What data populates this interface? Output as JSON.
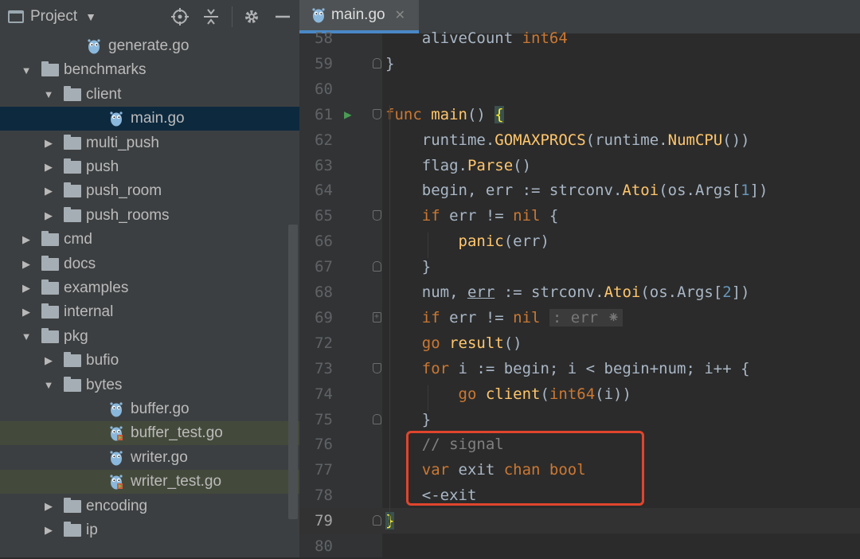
{
  "project_panel": {
    "title": "Project",
    "tree": [
      {
        "label": "generate.go",
        "type": "go",
        "indent": 110,
        "state": ""
      },
      {
        "label": "benchmarks",
        "type": "folder",
        "indent": 54,
        "expanded": true
      },
      {
        "label": "client",
        "type": "folder",
        "indent": 82,
        "expanded": true
      },
      {
        "label": "main.go",
        "type": "go",
        "indent": 138,
        "state": "selected"
      },
      {
        "label": "multi_push",
        "type": "folder",
        "indent": 82,
        "expanded": false
      },
      {
        "label": "push",
        "type": "folder",
        "indent": 82,
        "expanded": false
      },
      {
        "label": "push_room",
        "type": "folder",
        "indent": 82,
        "expanded": false
      },
      {
        "label": "push_rooms",
        "type": "folder",
        "indent": 82,
        "expanded": false
      },
      {
        "label": "cmd",
        "type": "folder",
        "indent": 54,
        "expanded": false
      },
      {
        "label": "docs",
        "type": "folder",
        "indent": 54,
        "expanded": false
      },
      {
        "label": "examples",
        "type": "folder",
        "indent": 54,
        "expanded": false
      },
      {
        "label": "internal",
        "type": "folder",
        "indent": 54,
        "expanded": false
      },
      {
        "label": "pkg",
        "type": "folder",
        "indent": 54,
        "expanded": true
      },
      {
        "label": "bufio",
        "type": "folder",
        "indent": 82,
        "expanded": false
      },
      {
        "label": "bytes",
        "type": "folder",
        "indent": 82,
        "expanded": true
      },
      {
        "label": "buffer.go",
        "type": "go",
        "indent": 138,
        "state": ""
      },
      {
        "label": "buffer_test.go",
        "type": "gotest",
        "indent": 138,
        "state": "modified"
      },
      {
        "label": "writer.go",
        "type": "go",
        "indent": 138,
        "state": ""
      },
      {
        "label": "writer_test.go",
        "type": "gotest",
        "indent": 138,
        "state": "modified"
      },
      {
        "label": "encoding",
        "type": "folder",
        "indent": 82,
        "expanded": false
      },
      {
        "label": "ip",
        "type": "folder",
        "indent": 82,
        "expanded": false
      }
    ],
    "icons": [
      "window-icon",
      "target-icon",
      "collapse-icon",
      "gear-icon",
      "minimize-icon"
    ]
  },
  "editor": {
    "tab": {
      "label": "main.go"
    },
    "lines": [
      {
        "no": "58",
        "tokens": [
          [
            "p",
            "    aliveCount "
          ],
          [
            "k",
            "int64"
          ]
        ]
      },
      {
        "no": "59",
        "tokens": [
          [
            "p",
            "}"
          ]
        ],
        "fold": "up"
      },
      {
        "no": "60",
        "tokens": []
      },
      {
        "no": "61",
        "tokens": [
          [
            "k",
            "func "
          ],
          [
            "fn",
            "main"
          ],
          [
            "p",
            "() "
          ],
          [
            "hl",
            "{"
          ]
        ],
        "run": true,
        "fold": "down"
      },
      {
        "no": "62",
        "tokens": [
          [
            "p",
            "    runtime."
          ],
          [
            "mc",
            "GOMAXPROCS"
          ],
          [
            "p",
            "(runtime."
          ],
          [
            "mc",
            "NumCPU"
          ],
          [
            "p",
            "())"
          ]
        ]
      },
      {
        "no": "63",
        "tokens": [
          [
            "p",
            "    flag."
          ],
          [
            "mc",
            "Parse"
          ],
          [
            "p",
            "()"
          ]
        ]
      },
      {
        "no": "64",
        "tokens": [
          [
            "p",
            "    begin, err := strconv."
          ],
          [
            "mc",
            "Atoi"
          ],
          [
            "p",
            "(os.Args["
          ],
          [
            "num",
            "1"
          ],
          [
            "p",
            "])"
          ]
        ]
      },
      {
        "no": "65",
        "tokens": [
          [
            "k",
            "    if "
          ],
          [
            "p",
            "err != "
          ],
          [
            "k",
            "nil "
          ],
          [
            "p",
            "{"
          ]
        ],
        "fold": "down"
      },
      {
        "no": "66",
        "tokens": [
          [
            "p",
            "        "
          ],
          [
            "fn",
            "panic"
          ],
          [
            "p",
            "(err)"
          ]
        ]
      },
      {
        "no": "67",
        "tokens": [
          [
            "p",
            "    }"
          ]
        ],
        "fold": "up"
      },
      {
        "no": "68",
        "tokens": [
          [
            "p",
            "    num, "
          ],
          [
            "u",
            "err"
          ],
          [
            "p",
            " := strconv."
          ],
          [
            "mc",
            "Atoi"
          ],
          [
            "p",
            "(os.Args["
          ],
          [
            "num",
            "2"
          ],
          [
            "p",
            "])"
          ]
        ]
      },
      {
        "no": "69",
        "tokens": [
          [
            "k",
            "    if "
          ],
          [
            "p",
            "err != "
          ],
          [
            "k",
            "nil "
          ],
          [
            "hint",
            ": err ⁕"
          ]
        ],
        "fold": "plus"
      },
      {
        "no": "72",
        "tokens": [
          [
            "k",
            "    go "
          ],
          [
            "fn",
            "result"
          ],
          [
            "p",
            "()"
          ]
        ]
      },
      {
        "no": "73",
        "tokens": [
          [
            "k",
            "    for "
          ],
          [
            "p",
            "i := begin; i < begin+num; i++ {"
          ]
        ],
        "fold": "down"
      },
      {
        "no": "74",
        "tokens": [
          [
            "k",
            "        go "
          ],
          [
            "fn",
            "client"
          ],
          [
            "p",
            "("
          ],
          [
            "k",
            "int64"
          ],
          [
            "p",
            "(i))"
          ]
        ]
      },
      {
        "no": "75",
        "tokens": [
          [
            "p",
            "    }"
          ]
        ],
        "fold": "up"
      },
      {
        "no": "76",
        "tokens": [
          [
            "cm",
            "    // signal"
          ]
        ]
      },
      {
        "no": "77",
        "tokens": [
          [
            "k",
            "    var "
          ],
          [
            "p",
            "exit "
          ],
          [
            "k",
            "chan bool"
          ]
        ]
      },
      {
        "no": "78",
        "tokens": [
          [
            "p",
            "    "
          ],
          [
            "dot",
            "<-exit"
          ]
        ]
      },
      {
        "no": "79",
        "tokens": [
          [
            "hl",
            "}"
          ]
        ],
        "fold": "up",
        "current": true
      },
      {
        "no": "80",
        "tokens": []
      }
    ]
  }
}
